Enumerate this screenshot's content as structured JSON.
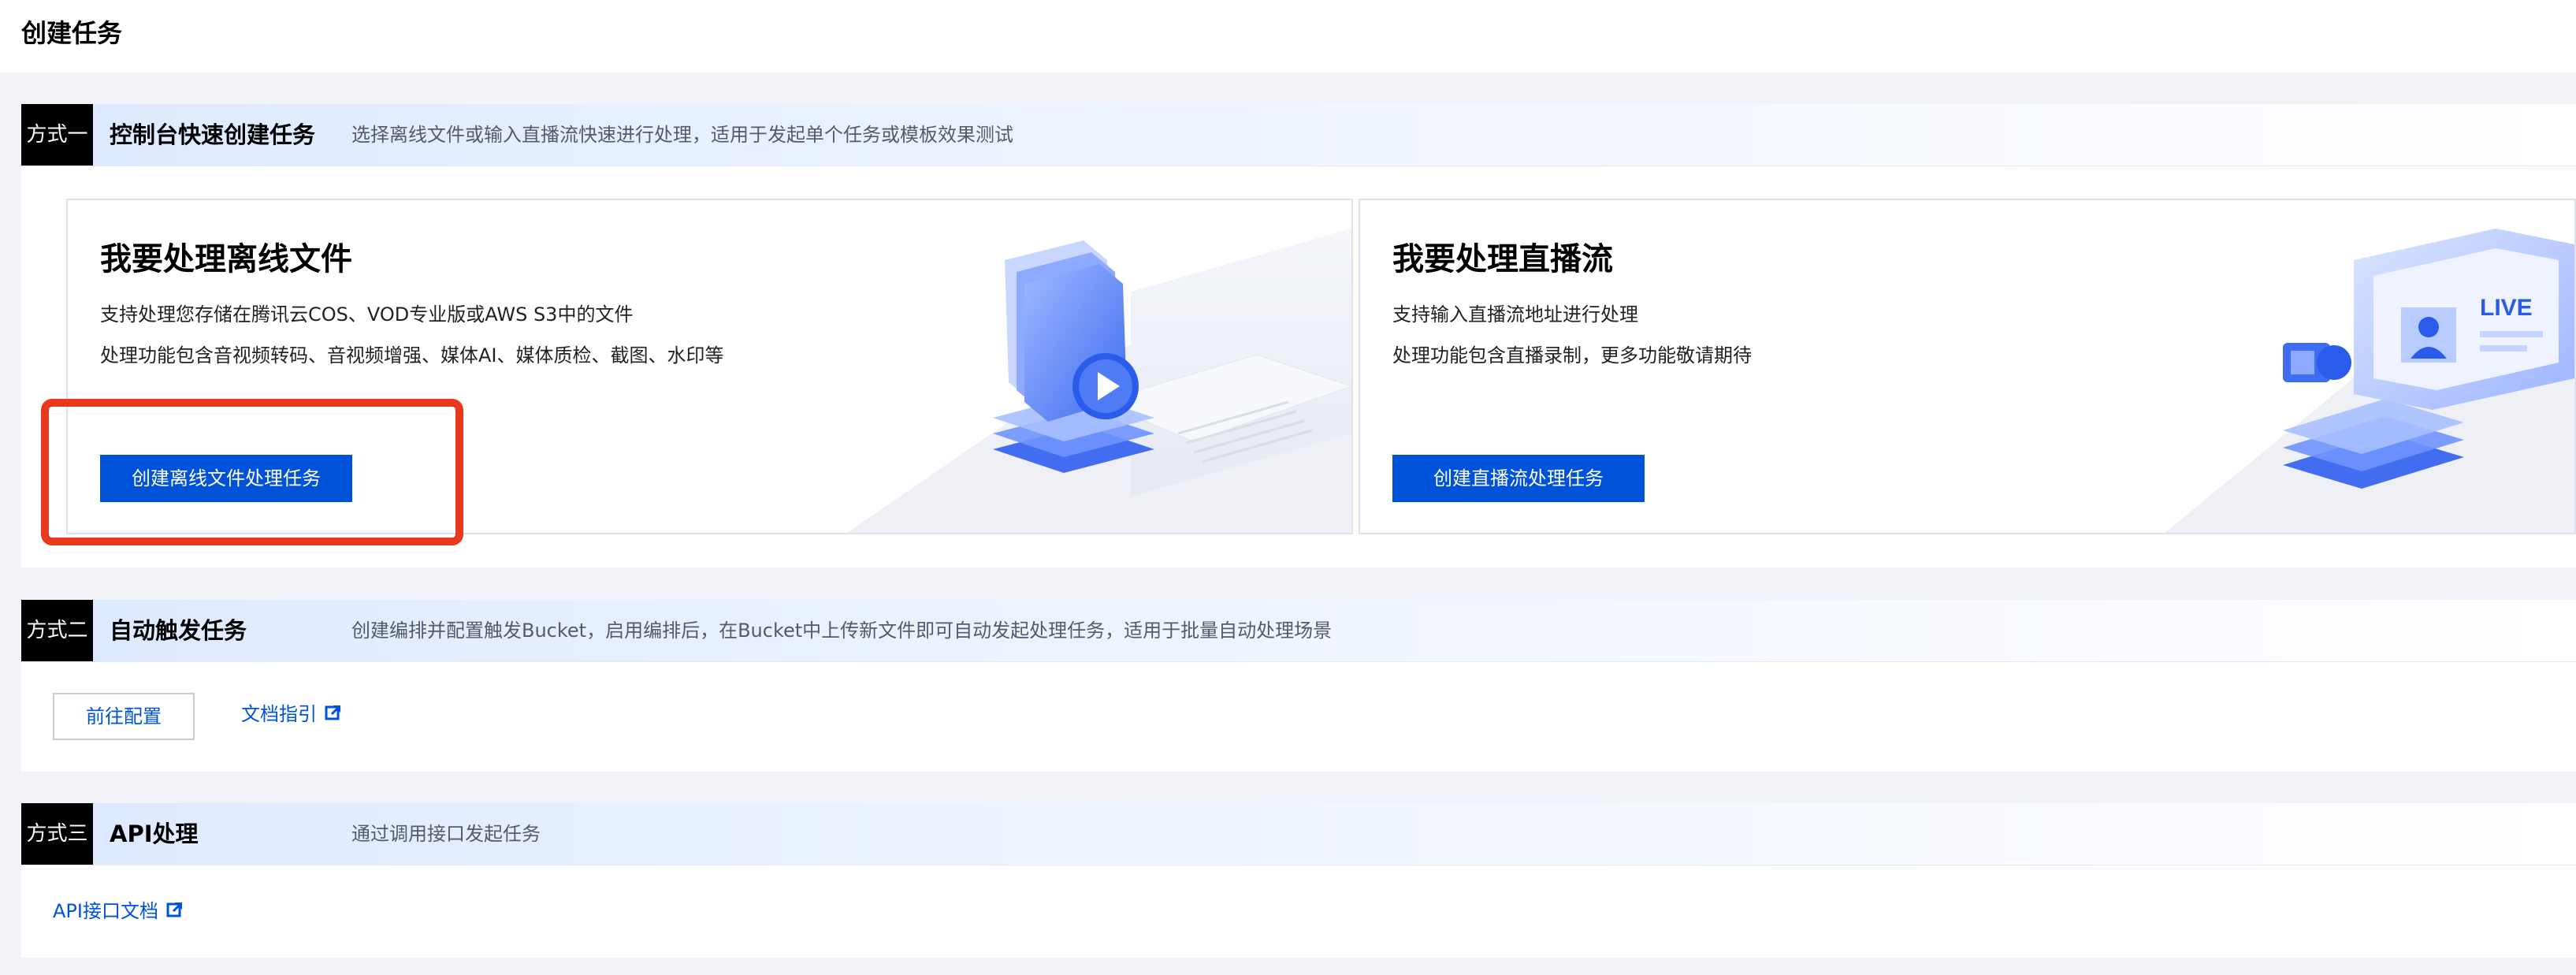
{
  "page": {
    "title": "创建任务"
  },
  "method1": {
    "tag": "方式一",
    "title": "控制台快速创建任务",
    "desc": "选择离线文件或输入直播流快速进行处理，适用于发起单个任务或模板效果测试",
    "offline": {
      "title": "我要处理离线文件",
      "line1": "支持处理您存储在腾讯云COS、VOD专业版或AWS S3中的文件",
      "line2": "处理功能包含音视频转码、音视频增强、媒体AI、媒体质检、截图、水印等",
      "button": "创建离线文件处理任务"
    },
    "live": {
      "title": "我要处理直播流",
      "line1": "支持输入直播流地址进行处理",
      "line2": "处理功能包含直播录制，更多功能敬请期待",
      "button": "创建直播流处理任务",
      "screen_text": "LIVE"
    }
  },
  "method2": {
    "tag": "方式二",
    "title": "自动触发任务",
    "desc": "创建编排并配置触发Bucket，启用编排后，在Bucket中上传新文件即可自动发起处理任务，适用于批量自动处理场景",
    "config_button": "前往配置",
    "doc_link": "文档指引"
  },
  "method3": {
    "tag": "方式三",
    "title": "API处理",
    "desc": "通过调用接口发起任务",
    "api_link": "API接口文档"
  },
  "icons": {
    "external": "external-link-icon",
    "folder": "folder-play-illustration",
    "live": "live-screen-illustration"
  },
  "colors": {
    "primary": "#0052d9",
    "highlight": "#e8391c",
    "tag_bg": "#000000",
    "page_bg": "#f2f3f8"
  }
}
